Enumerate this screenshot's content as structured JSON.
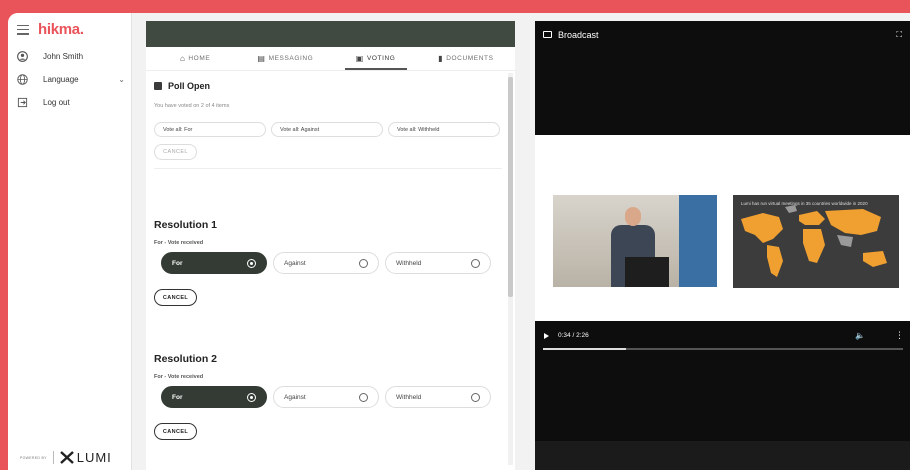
{
  "sidebar": {
    "brand": "hikma.",
    "user_name": "John Smith",
    "language_label": "Language",
    "logout_label": "Log out",
    "powered_by": "POWERED BY",
    "powered_logo": "LUMI"
  },
  "tabs": [
    {
      "label": "HOME",
      "icon": "home-icon",
      "active": false
    },
    {
      "label": "MESSAGING",
      "icon": "messaging-icon",
      "active": false
    },
    {
      "label": "VOTING",
      "icon": "voting-icon",
      "active": true
    },
    {
      "label": "DOCUMENTS",
      "icon": "documents-icon",
      "active": false
    }
  ],
  "poll": {
    "title": "Poll Open",
    "voted_text": "You have voted on 2 of 4 items",
    "vote_all_for": "Vote all: For",
    "vote_all_against": "Vote all: Against",
    "vote_all_withheld": "Vote all: Withheld",
    "cancel_label": "CANCEL"
  },
  "resolutions": [
    {
      "title": "Resolution 1",
      "status": "For - Vote received",
      "choices": [
        "For",
        "Against",
        "Withheld"
      ],
      "selected": "For",
      "cancel_label": "CANCEL"
    },
    {
      "title": "Resolution 2",
      "status": "For - Vote received",
      "choices": [
        "For",
        "Against",
        "Withheld"
      ],
      "selected": "For",
      "cancel_label": "CANCEL"
    }
  ],
  "broadcast": {
    "title": "Broadcast",
    "map_caption": "Lumi has run virtual meetings in 35 countries worldwide in 2020",
    "time": "0:34 / 2:26",
    "progress": 0.23
  },
  "colors": {
    "brand": "#e9545a",
    "dark_green": "#343b34"
  }
}
